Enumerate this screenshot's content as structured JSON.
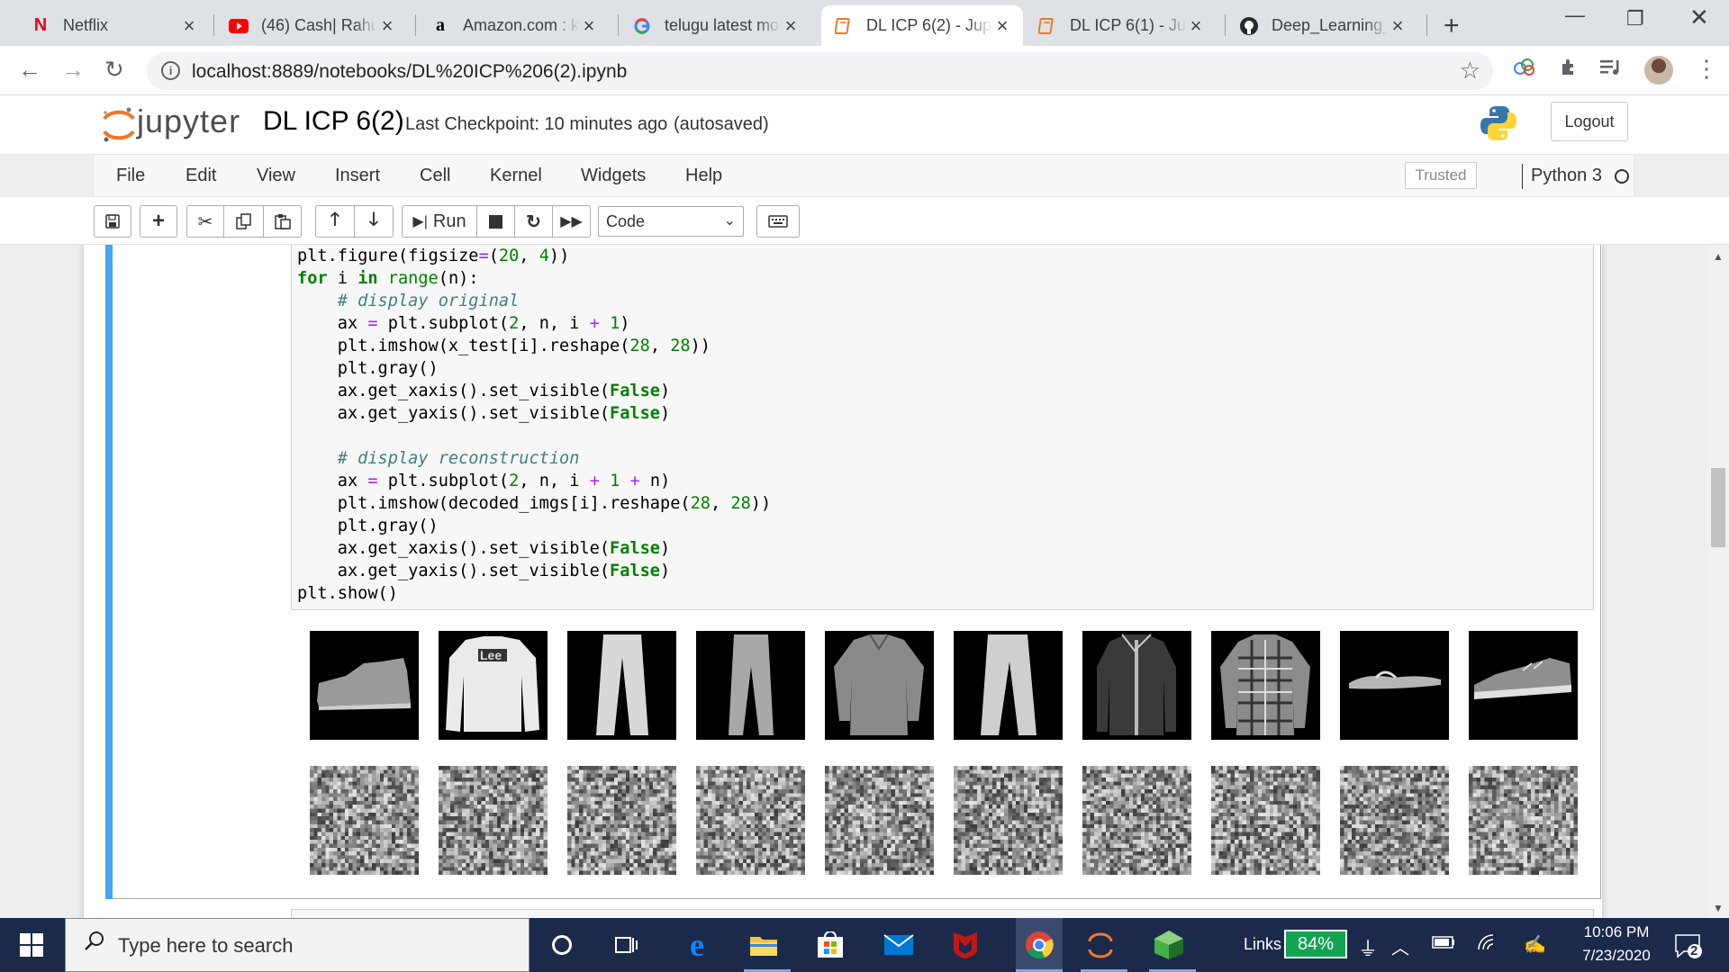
{
  "browser": {
    "tabs": [
      {
        "title": "Netflix",
        "icon": "netflix-icon",
        "active": false
      },
      {
        "title": "(46) Cash| Rahul",
        "icon": "youtube-icon",
        "active": false
      },
      {
        "title": "Amazon.com : k",
        "icon": "amazon-icon",
        "active": false
      },
      {
        "title": "telugu latest mo",
        "icon": "google-icon",
        "active": false
      },
      {
        "title": "DL ICP 6(2) - Jup",
        "icon": "jupyter-tab-icon",
        "active": true
      },
      {
        "title": "DL ICP 6(1) - Jup",
        "icon": "jupyter-tab-icon",
        "active": false
      },
      {
        "title": "Deep_Learning_",
        "icon": "github-icon",
        "active": false
      }
    ],
    "url": "localhost:8889/notebooks/DL%20ICP%206(2).ipynb"
  },
  "jupyter": {
    "logo_text": "jupyter",
    "notebook_name": "DL ICP 6(2)",
    "checkpoint": "Last Checkpoint: 10 minutes ago",
    "autosave": "(autosaved)",
    "logout_label": "Logout",
    "menu": [
      "File",
      "Edit",
      "View",
      "Insert",
      "Cell",
      "Kernel",
      "Widgets",
      "Help"
    ],
    "trusted_label": "Trusted",
    "kernel_name": "Python 3",
    "run_label": "Run",
    "cell_type": "Code"
  },
  "cell": {
    "code_lines": [
      "plt.figure(figsize=(20, 4))",
      "for i in range(n):",
      "    # display original",
      "    ax = plt.subplot(2, n, i + 1)",
      "    plt.imshow(x_test[i].reshape(28, 28))",
      "    plt.gray()",
      "    ax.get_xaxis().set_visible(False)",
      "    ax.get_yaxis().set_visible(False)",
      "",
      "    # display reconstruction",
      "    ax = plt.subplot(2, n, i + 1 + n)",
      "    plt.imshow(decoded_imgs[i].reshape(28, 28))",
      "    plt.gray()",
      "    ax.get_xaxis().set_visible(False)",
      "    ax.get_yaxis().set_visible(False)",
      "plt.show()"
    ],
    "original_images": [
      "ankle-boot",
      "pullover",
      "trouser",
      "trouser",
      "shirt",
      "trouser",
      "coat",
      "shirt",
      "sandal",
      "sneaker"
    ],
    "reconstructed_images": [
      "noise",
      "noise",
      "noise",
      "noise",
      "noise",
      "noise",
      "noise",
      "noise",
      "noise",
      "noise"
    ]
  },
  "taskbar": {
    "search_placeholder": "Type here to search",
    "links_label": "Links",
    "battery": "84%",
    "time": "10:06 PM",
    "date": "7/23/2020",
    "notification_count": "2"
  },
  "colors": {
    "cell_selected": "#42a5f5",
    "jupyter_orange": "#f37726",
    "taskbar": "#1b2a4a",
    "battery": "#14a350"
  }
}
